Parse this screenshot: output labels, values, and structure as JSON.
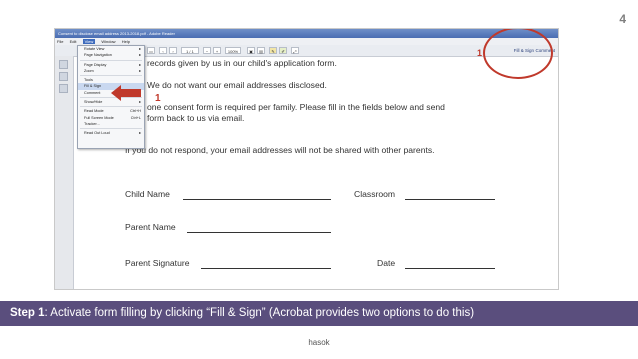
{
  "slide_number": "4",
  "window": {
    "title": "Consent to disclose email address 2013-2018.pdf - Adobe Reader",
    "menus": [
      "File",
      "Edit",
      "View",
      "Window",
      "Help"
    ],
    "active_menu": "View"
  },
  "toolbar": {
    "page_indicator": "1 / 1",
    "zoom": "100%",
    "fill_sign": "Fill & Sign",
    "comment": "Comment"
  },
  "view_menu": {
    "items": [
      {
        "label": "Rotate View",
        "submenu": true
      },
      {
        "label": "Page Navigation",
        "submenu": true
      },
      {
        "label": "Page Display",
        "submenu": true
      },
      {
        "label": "Zoom",
        "submenu": true
      },
      {
        "label": "Tools",
        "submenu": false
      },
      {
        "label": "Fill & Sign",
        "submenu": false,
        "highlighted": true
      },
      {
        "label": "Comment",
        "submenu": false
      },
      {
        "label": "Show/Hide",
        "submenu": true
      },
      {
        "label": "Read Mode",
        "shortcut": "Ctrl+H"
      },
      {
        "label": "Full Screen Mode",
        "shortcut": "Ctrl+L"
      },
      {
        "label": "Tracker..."
      },
      {
        "label": "Read Out Loud",
        "submenu": true
      }
    ]
  },
  "document": {
    "line1": "records given by us in our child's application form.",
    "line2": "We do not want our email addresses disclosed.",
    "line3": "one consent form is required per family.  Please fill in the fields below and send",
    "line4": "form back to us via email.",
    "line5": "If you do not respond, your email addresses will not be shared with other parents.",
    "child_name": "Child Name",
    "classroom": "Classroom",
    "parent_name": "Parent Name",
    "parent_signature": "Parent Signature",
    "date": "Date"
  },
  "annotations": {
    "marker_left": "1",
    "marker_right": "1",
    "color": "#c0392b"
  },
  "step": {
    "label": "Step 1",
    "text": ": Activate form filling by clicking “Fill & Sign” (Acrobat provides two options to do this)"
  },
  "footer": "hasok"
}
